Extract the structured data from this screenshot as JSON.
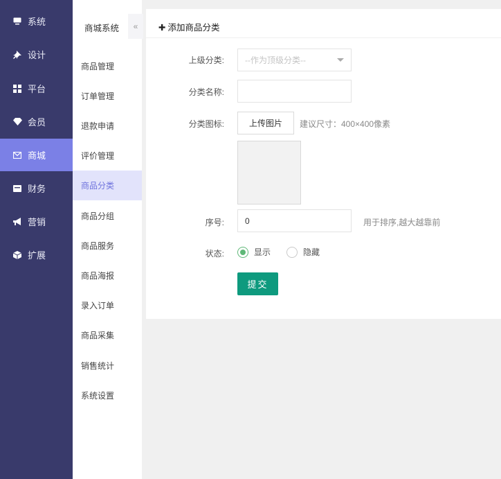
{
  "sidebar": {
    "items": [
      {
        "icon": "monitor-icon",
        "label": "系统",
        "active": false
      },
      {
        "icon": "pushpin-icon",
        "label": "设计",
        "active": false
      },
      {
        "icon": "grid-icon",
        "label": "平台",
        "active": false
      },
      {
        "icon": "diamond-icon",
        "label": "会员",
        "active": false
      },
      {
        "icon": "mail-icon",
        "label": "商城",
        "active": true
      },
      {
        "icon": "wallet-icon",
        "label": "财务",
        "active": false
      },
      {
        "icon": "megaphone-icon",
        "label": "营销",
        "active": false
      },
      {
        "icon": "puzzle-icon",
        "label": "扩展",
        "active": false
      }
    ]
  },
  "submenu": {
    "title": "商城系统",
    "collapse_glyph": "«",
    "items": [
      {
        "label": "商品管理",
        "active": false
      },
      {
        "label": "订单管理",
        "active": false
      },
      {
        "label": "退款申请",
        "active": false
      },
      {
        "label": "评价管理",
        "active": false
      },
      {
        "label": "商品分类",
        "active": true
      },
      {
        "label": "商品分组",
        "active": false
      },
      {
        "label": "商品服务",
        "active": false
      },
      {
        "label": "商品海报",
        "active": false
      },
      {
        "label": "录入订单",
        "active": false
      },
      {
        "label": "商品采集",
        "active": false
      },
      {
        "label": "销售统计",
        "active": false
      },
      {
        "label": "系统设置",
        "active": false
      }
    ]
  },
  "form": {
    "title": "添加商品分类",
    "parent_label": "上级分类:",
    "parent_value": "--作为顶级分类--",
    "name_label": "分类名称:",
    "name_value": "",
    "icon_label": "分类图标:",
    "upload_label": "上传图片",
    "icon_hint": "建议尺寸：400×400像素",
    "sort_label": "序号:",
    "sort_value": "0",
    "sort_hint": "用于排序,越大越靠前",
    "status_label": "状态:",
    "status_options": [
      {
        "label": "显示",
        "checked": true
      },
      {
        "label": "隐藏",
        "checked": false
      }
    ],
    "submit_label": "提交"
  },
  "colors": {
    "sidebar_bg": "#393a6b",
    "sidebar_active": "#7b80e6",
    "submenu_active_bg": "#e2e3fb",
    "submenu_active_text": "#6f73dd",
    "submit_bg": "#0e9a7e",
    "radio_checked": "#5fb878"
  }
}
